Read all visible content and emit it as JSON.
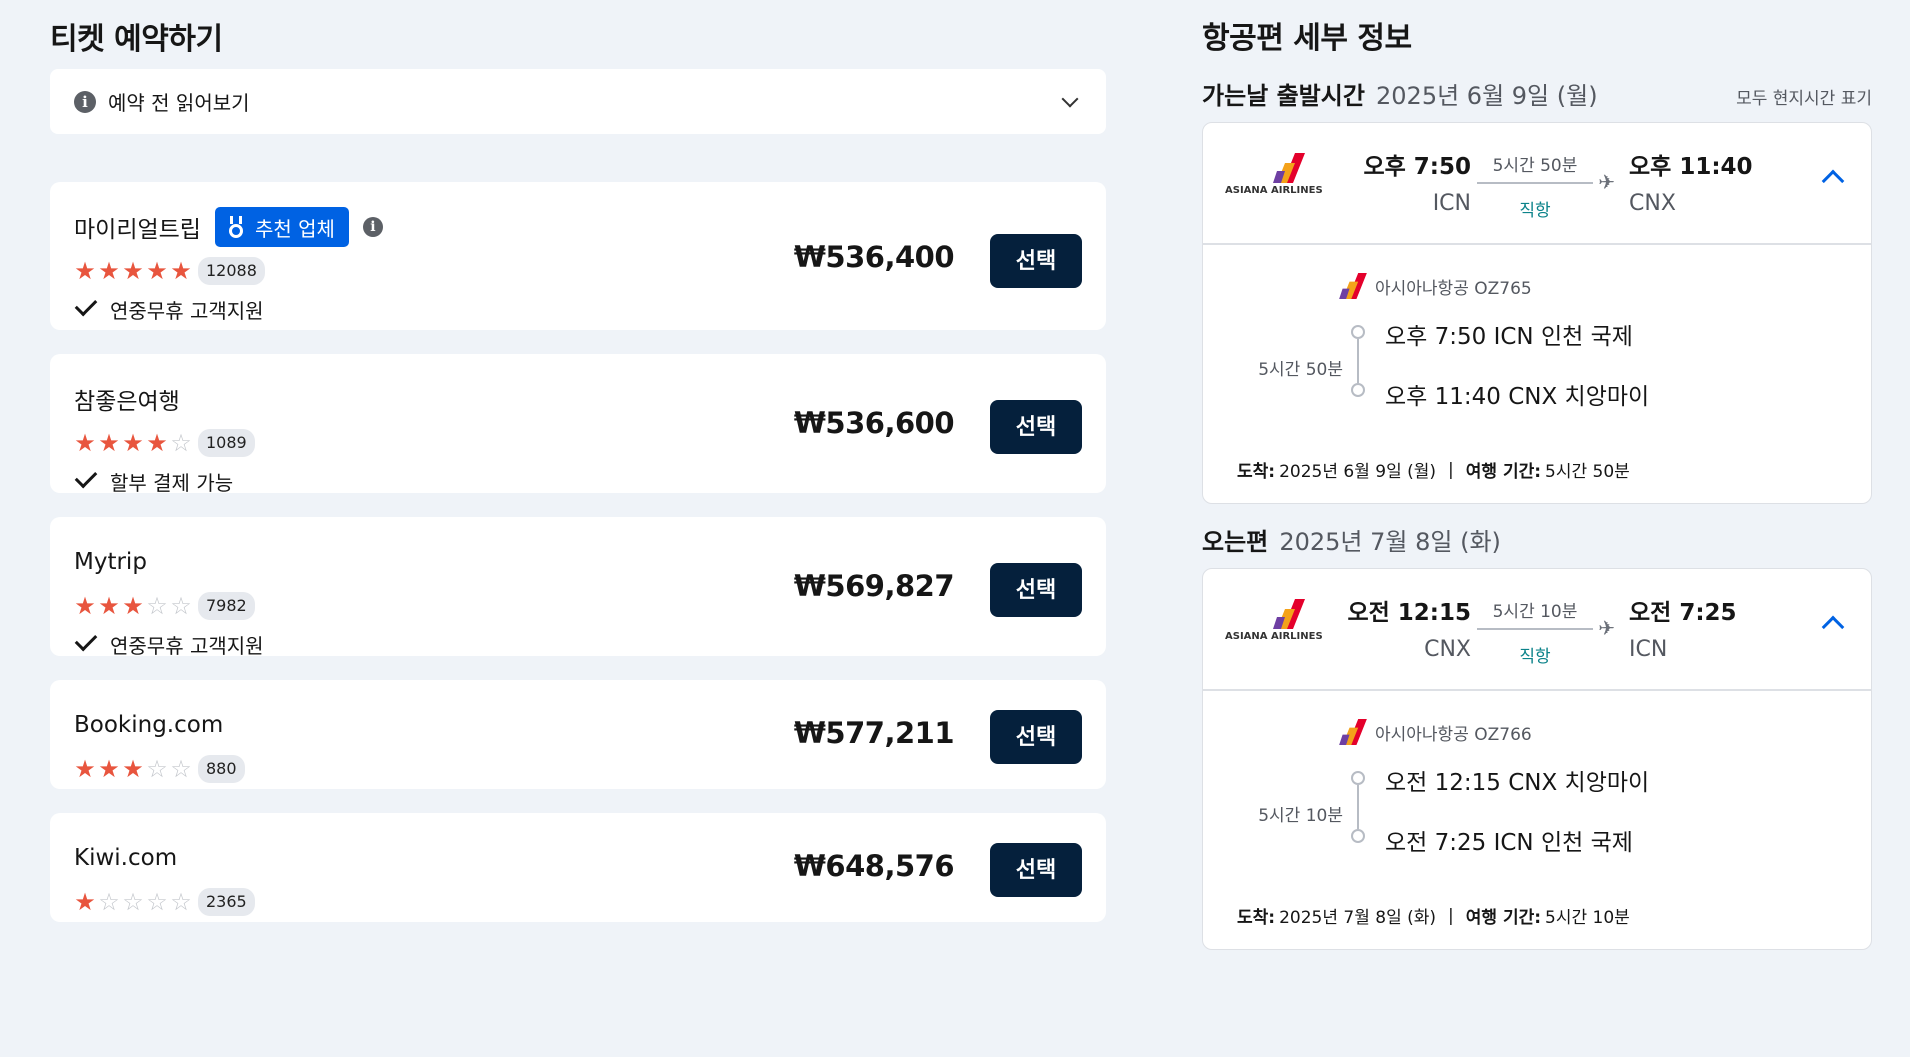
{
  "booking": {
    "title": "티켓 예약하기",
    "notice_label": "예약 전 읽어보기",
    "select_label": "선택",
    "providers": [
      {
        "name": "마이리얼트립",
        "badge": "추천 업체",
        "rating": 5,
        "reviews": "12088",
        "feature": "연중무휴 고객지원",
        "price": "₩536,400"
      },
      {
        "name": "참좋은여행",
        "badge": "",
        "rating": 4,
        "reviews": "1089",
        "feature": "할부 결제 가능",
        "price": "₩536,600"
      },
      {
        "name": "Mytrip",
        "badge": "",
        "rating": 3,
        "reviews": "7982",
        "feature": "연중무휴 고객지원",
        "price": "₩569,827"
      },
      {
        "name": "Booking.com",
        "badge": "",
        "rating": 3,
        "reviews": "880",
        "feature": "",
        "price": "₩577,211"
      },
      {
        "name": "Kiwi.com",
        "badge": "",
        "rating": 1,
        "reviews": "2365",
        "feature": "",
        "price": "₩648,576"
      }
    ]
  },
  "details": {
    "title": "항공편 세부 정보",
    "local_time_note": "모두 현지시간 표기",
    "airline_logo_text": "ASIANA AIRLINES",
    "legs": [
      {
        "label": "가는날 출발시간",
        "date": "2025년 6월 9일 (월)",
        "dep_time": "오후 7:50",
        "dep_code": "ICN",
        "duration": "5시간 50분",
        "direct": "직항",
        "arr_time": "오후 11:40",
        "arr_code": "CNX",
        "flight": "아시아나항공 OZ765",
        "stop1": "오후 7:50 ICN 인천 국제",
        "stop2": "오후 11:40 CNX 치앙마이",
        "arrive_label": "도착:",
        "arrive_value": "2025년 6월 9일 (월)",
        "trip_label": "여행 기간:",
        "trip_value": "5시간 50분"
      },
      {
        "label": "오는편",
        "date": "2025년 7월 8일 (화)",
        "dep_time": "오전 12:15",
        "dep_code": "CNX",
        "duration": "5시간 10분",
        "direct": "직항",
        "arr_time": "오전 7:25",
        "arr_code": "ICN",
        "flight": "아시아나항공 OZ766",
        "stop1": "오전 12:15 CNX 치앙마이",
        "stop2": "오전 7:25 ICN 인천 국제",
        "arrive_label": "도착:",
        "arrive_value": "2025년 7월 8일 (화)",
        "trip_label": "여행 기간:",
        "trip_value": "5시간 10분"
      }
    ]
  },
  "colors": {
    "accent_blue": "#0062e3",
    "button_navy": "#05203c",
    "star_orange": "#e8553e",
    "direct_teal": "#0c838a",
    "background": "#eff3f8"
  }
}
